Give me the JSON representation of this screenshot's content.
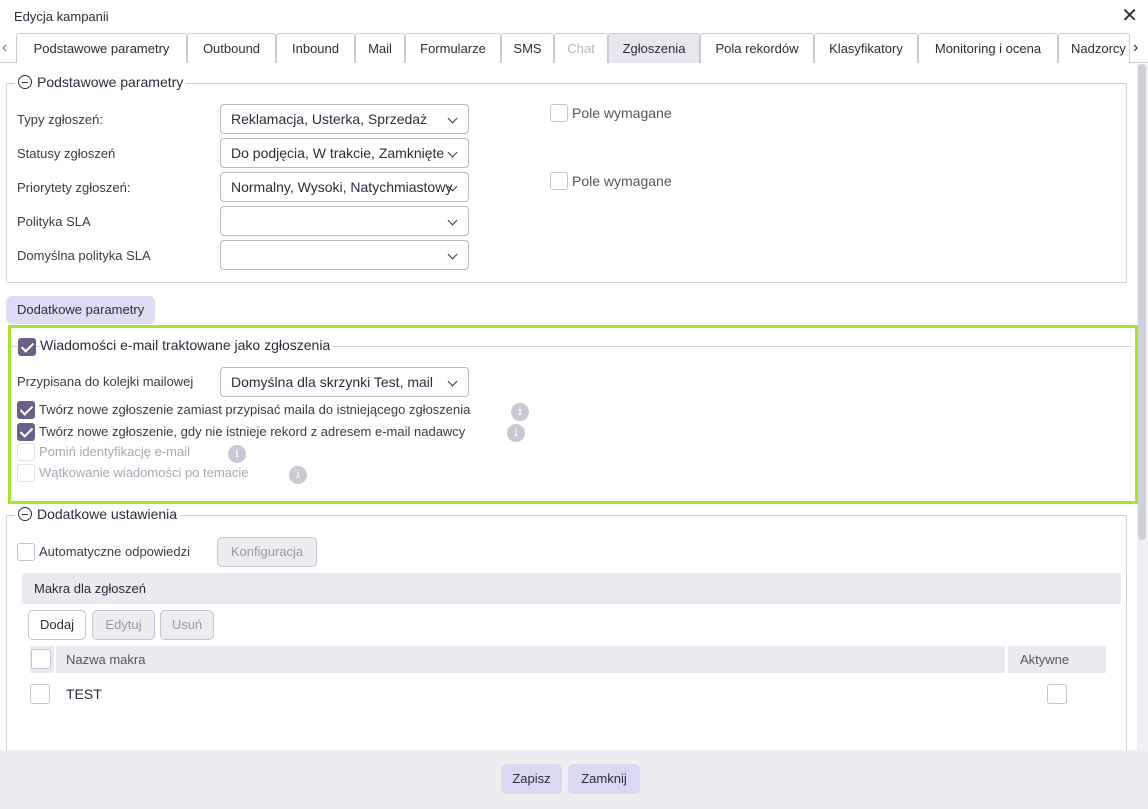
{
  "dialog": {
    "title": "Edycja kampanii"
  },
  "tabs": [
    {
      "label": "Podstawowe parametry"
    },
    {
      "label": "Outbound"
    },
    {
      "label": "Inbound"
    },
    {
      "label": "Mail"
    },
    {
      "label": "Formularze"
    },
    {
      "label": "SMS"
    },
    {
      "label": "Chat"
    },
    {
      "label": "Zgłoszenia"
    },
    {
      "label": "Pola rekordów"
    },
    {
      "label": "Klasyfikatory"
    },
    {
      "label": "Monitoring i ocena"
    },
    {
      "label": "Nadzorcy"
    }
  ],
  "active_tab": "Zgłoszenia",
  "basic": {
    "legend": "Podstawowe parametry",
    "ticket_types_label": "Typy zgłoszeń:",
    "ticket_types_value": "Reklamacja, Usterka, Sprzedaż",
    "ticket_statuses_label": "Statusy zgłoszeń",
    "ticket_statuses_value": "Do podjęcia, W trakcie, Zamknięte",
    "ticket_priorities_label": "Priorytety zgłoszeń:",
    "ticket_priorities_value": "Normalny, Wysoki, Natychmiastowy",
    "sla_policy_label": "Polityka SLA",
    "sla_policy_value": "",
    "default_sla_label": "Domyślna polityka SLA",
    "default_sla_value": "",
    "required_label_1": "Pole wymagane",
    "required_label_2": "Pole wymagane"
  },
  "extra_params_label": "Dodatkowe parametry",
  "email_section": {
    "legend": "Wiadomości e-mail traktowane jako zgłoszenia",
    "queue_label": "Przypisana do kolejki mailowej",
    "queue_value": "Domyślna dla skrzynki Test, mail",
    "option_create_new": "Twórz nowe zgłoszenie zamiast przypisać maila do istniejącego zgłoszenia",
    "option_no_record": "Twórz nowe zgłoszenie, gdy nie istnieje rekord z adresem e-mail nadawcy",
    "option_skip_ident": "Pomiń identyfikację e-mail",
    "option_threading": "Wątkowanie wiadomości po temacie"
  },
  "additional": {
    "legend": "Dodatkowe ustawienia",
    "auto_reply_label": "Automatyczne odpowiedzi",
    "config_button": "Konfiguracja"
  },
  "macros": {
    "header": "Makra dla zgłoszeń",
    "add_button": "Dodaj",
    "edit_button": "Edytuj",
    "delete_button": "Usuń",
    "col_name": "Nazwa makra",
    "col_active": "Aktywne",
    "rows": [
      {
        "name": "TEST"
      }
    ]
  },
  "footer": {
    "save_button": "Zapisz",
    "close_button": "Zamknij"
  }
}
